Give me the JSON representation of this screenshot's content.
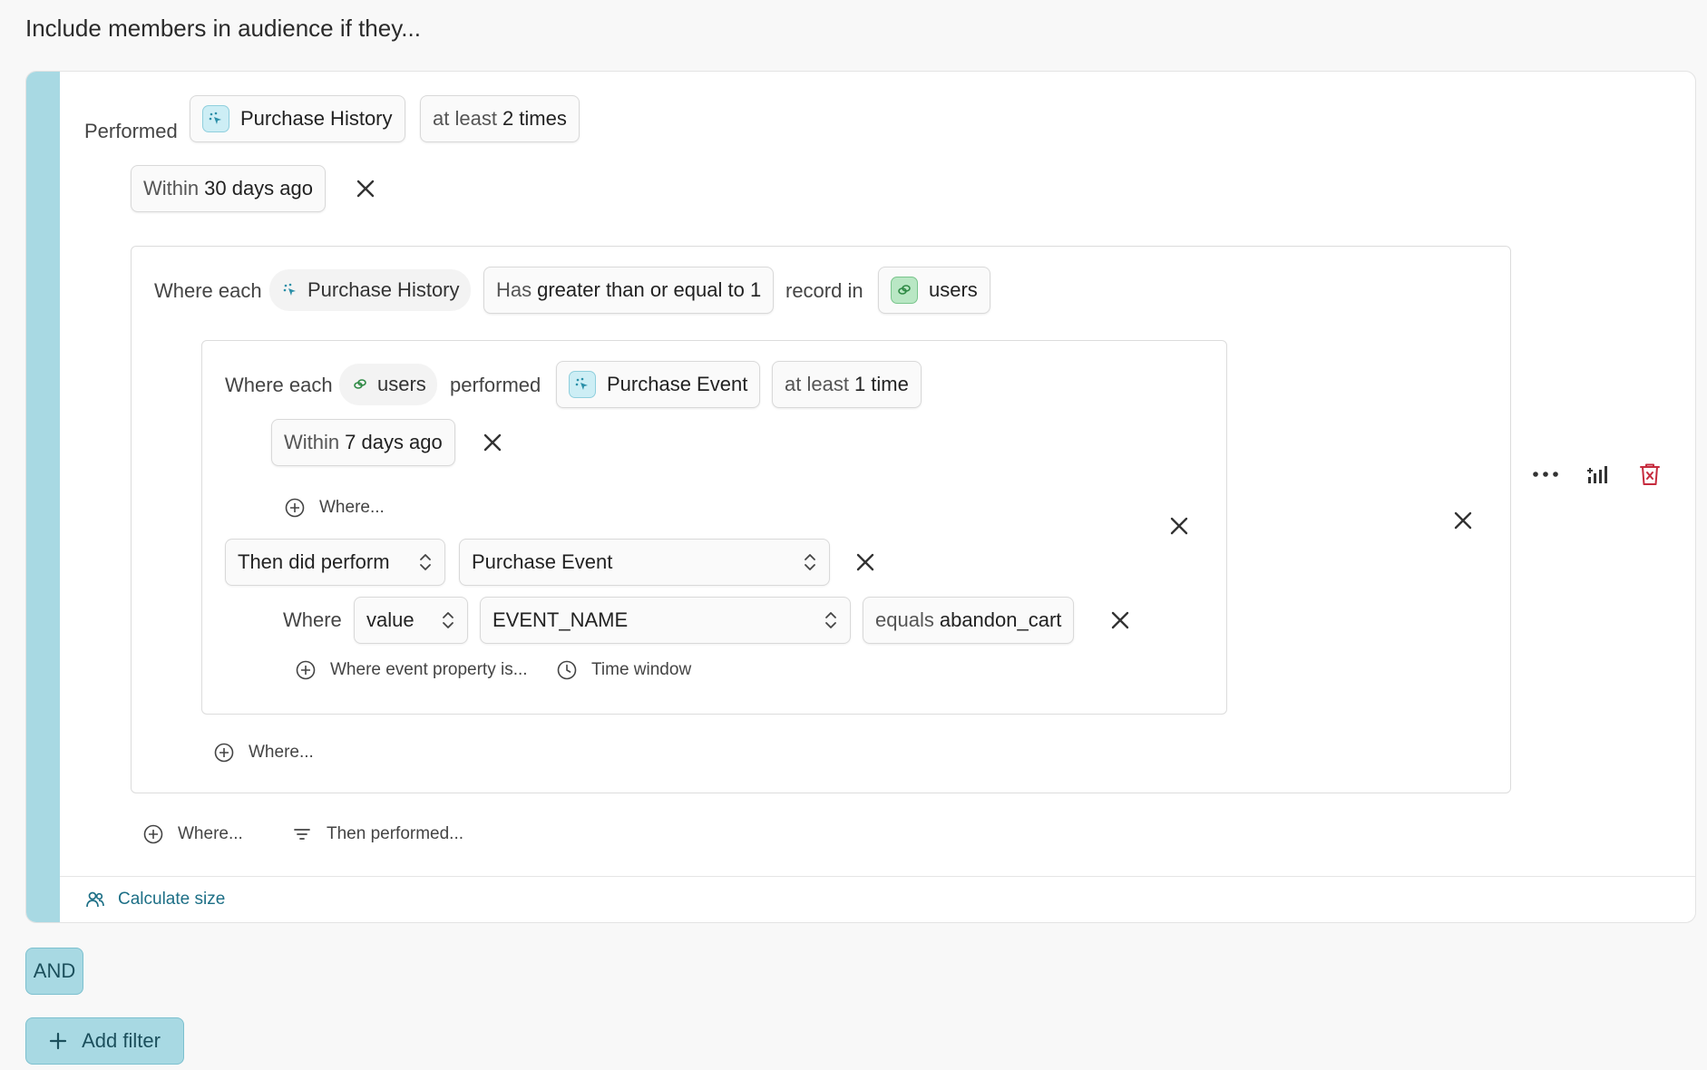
{
  "heading": "Include members in audience if they...",
  "root": {
    "performed_label": "Performed",
    "event": "Purchase History",
    "frequency_prefix": "at least",
    "frequency_value": "2 times",
    "time_prefix": "Within",
    "time_value": "30 days ago"
  },
  "nested": {
    "where_each_label": "Where each",
    "entity": "Purchase History",
    "has_prefix": "Has",
    "has_value": "greater than or equal to 1",
    "record_in_label": "record in",
    "related_table": "users"
  },
  "inner": {
    "where_each_label": "Where each",
    "entity": "users",
    "performed_label": "performed",
    "event": "Purchase Event",
    "frequency_prefix": "at least",
    "frequency_value": "1 time",
    "time_prefix": "Within",
    "time_value": "7 days ago",
    "add_where": "Where...",
    "sequence_select": "Then did perform",
    "sequence_event": "Purchase Event",
    "where_label": "Where",
    "property_type": "value",
    "property_name": "EVENT_NAME",
    "condition_prefix": "equals",
    "condition_value": "abandon_cart",
    "add_event_property": "Where event property is...",
    "add_time_window": "Time window"
  },
  "nested_add_where": "Where...",
  "root_add_where": "Where...",
  "root_then_performed": "Then performed...",
  "calculate_size": "Calculate size",
  "and_label": "AND",
  "add_filter": "Add filter",
  "colors": {
    "accent_stripe": "#a8d9e3",
    "link": "#1d6f86",
    "delete": "#c62a3d"
  },
  "icons": [
    "event-icon",
    "database-icon",
    "close-icon",
    "plus-circle-icon",
    "clock-icon",
    "filter-icon",
    "users-icon",
    "more-icon",
    "chart-icon",
    "trash-icon",
    "chevron-updown-icon",
    "plus-icon"
  ]
}
